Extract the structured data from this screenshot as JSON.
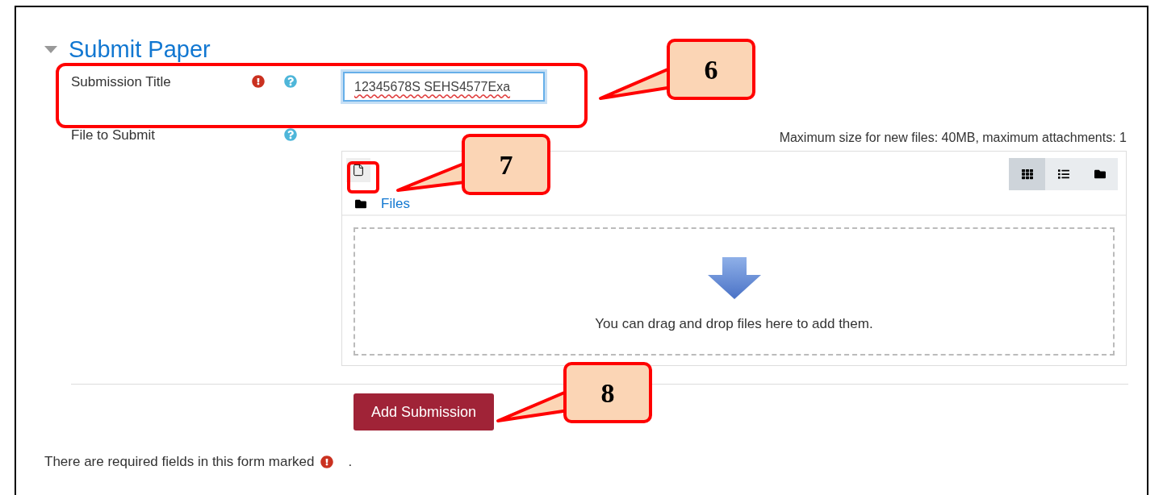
{
  "section": {
    "title": "Submit Paper",
    "expanded": true
  },
  "fields": [
    {
      "kind": "text",
      "label": "Submission Title",
      "required": true,
      "help": true,
      "value": "12345678S SEHS4577Exa"
    },
    {
      "kind": "file",
      "label": "File to Submit",
      "required": false,
      "help": true,
      "limits": "Maximum size for new files: 40MB, maximum attachments: 1",
      "path": "Files",
      "drop_hint": "You can drag and drop files here to add them.",
      "views": [
        {
          "kind": "grid",
          "selected": true
        },
        {
          "kind": "list",
          "selected": false
        },
        {
          "kind": "tree",
          "selected": false
        }
      ]
    }
  ],
  "submit_button": "Add Submission",
  "footer": {
    "before": "There are required fields in this form marked",
    "after": "."
  },
  "callouts": [
    {
      "number": "6"
    },
    {
      "number": "7"
    },
    {
      "number": "8"
    }
  ]
}
